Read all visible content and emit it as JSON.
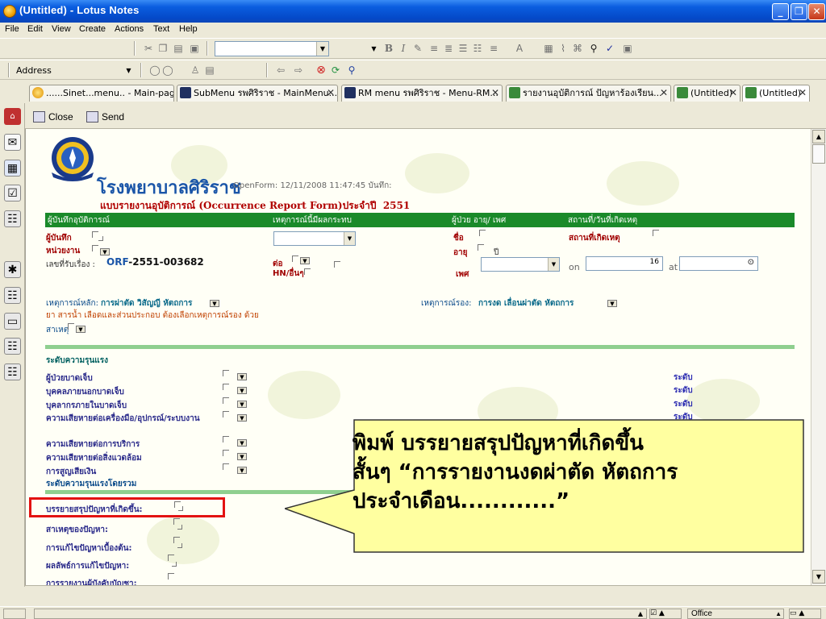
{
  "window": {
    "title": "(Untitled) - Lotus Notes"
  },
  "menu": [
    "File",
    "Edit",
    "View",
    "Create",
    "Actions",
    "Text",
    "Help"
  ],
  "address": {
    "label": "Address",
    "value": ""
  },
  "tabs": [
    {
      "label": "......Sinet...menu.. - Main-page..."
    },
    {
      "label": "SubMenu รพศิริราช - MainMenu..."
    },
    {
      "label": "RM menu รพศิริราช - Menu-RM..."
    },
    {
      "label": "รายงานอุบัติการณ์ ปัญหาร้องเรียน..."
    },
    {
      "label": "(Untitled)"
    },
    {
      "label": "(Untitled)"
    }
  ],
  "actions": {
    "close": "Close",
    "send": "Send"
  },
  "form": {
    "hospital": "โรงพยาบาลศิริราช",
    "openform": "OpenForm: 12/11/2008 11:47:45  บันทึก:",
    "title": "แบบรายงานอุบัติการณ์ (Occurrence Report Form)ประจำปี",
    "year": "2551",
    "header": {
      "recorder": "ผู้บันทึกอุบัติการณ์",
      "event_col": "เหตุการณ์นี้มีผลกระทบ",
      "patient_col": "ผู้ป่วย  อายุ/ เพศ",
      "place_col": "สถานที่/วันที่เกิดเหตุ"
    },
    "recorder_label": "ผู้บันทึก",
    "unit_label": "หน่วยงาน",
    "receipt_label": "เลขที่รับเรื่อง",
    "receipt_value": "ORF-2551-003682",
    "to_label": "ต่อ",
    "hn_label": "HN/อื่นๆ",
    "name_label": "ชื่อ",
    "age_label": "อายุ",
    "age_unit": "ปี",
    "sex_label": "เพศ",
    "place_label": "สถานที่เกิดเหตุ",
    "on_label": "on",
    "on_value": "16",
    "at_label": "at",
    "main_event_label": "เหตุการณ์หลัก:",
    "main_event_value": "การผ่าตัด วิสัญญี หัตถการ",
    "main_event_note": "ยา สารน้ำ เลือดและส่วนประกอบ ต้องเลือกเหตุการณ์รอง ด้วย",
    "cause_label": "สาเหตุ",
    "sub_event_label": "เหตุการณ์รอง:",
    "sub_event_value": "การงด เลื่อนผ่าตัด หัตถการ",
    "severity_heading": "ระดับความรุนแรง",
    "severity_items": [
      "ผู้ป่วยบาดเจ็บ",
      "บุคคลภายนอกบาดเจ็บ",
      "บุคลากรภายในบาดเจ็บ",
      "ความเสียหายต่อเครื่องมือ/อุปกรณ์/ระบบงาน",
      "ความเสียหายต่อการบริการ",
      "ความเสียหายต่อสิ่งแวดล้อม",
      "การสูญเสียเงิน"
    ],
    "level_label": "ระดับ",
    "overall_severity": "ระดับความรุนแรงโดยรวม",
    "summary_label": "บรรยายสรุปปัญหาที่เกิดขึ้น:",
    "cause_problem_label": "สาเหตุของปัญหา:",
    "initial_fix_label": "การแก้ไขปัญหาเบื้องต้น:",
    "fix_result_label": "ผลลัพธ์การแก้ไขปัญหา:",
    "report_label": "การรายงานผู้บังคับบัญชา:"
  },
  "callout": {
    "lines": [
      "พิมพ์ บรรยายสรุปปัญหาที่เกิดขึ้น",
      "สั้นๆ “การรายงานงดผ่าตัด หัตถการ",
      "ประจำเดือน............”"
    ]
  },
  "status": {
    "office": "Office"
  },
  "colors": {
    "titlebar": "#0b5ee0",
    "greenbar": "#1a8a2a",
    "highlight": "#e31212",
    "callout_bg": "#ffffa0"
  },
  "icons": [
    "lotus-logo-icon",
    "close-icon",
    "send-icon",
    "mail-icon",
    "calendar-icon",
    "contacts-icon",
    "todo-icon",
    "replicator-icon",
    "bookmark-icon",
    "clock-icon",
    "search-icon",
    "back-icon",
    "forward-icon",
    "stop-icon",
    "refresh-icon"
  ]
}
